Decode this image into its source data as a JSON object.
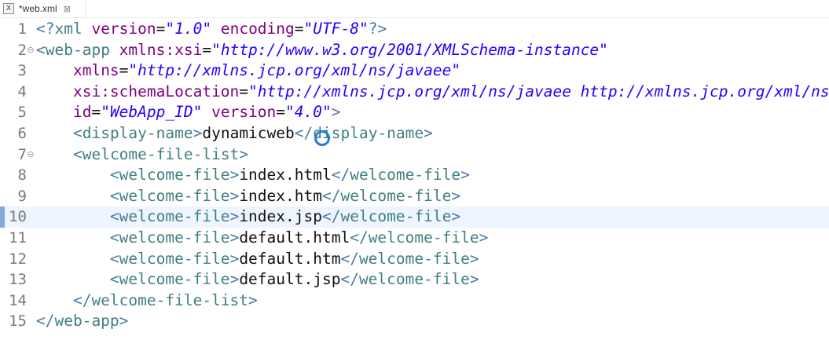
{
  "tab": {
    "icon_label": "X",
    "label": "*web.xml",
    "close": "⊠"
  },
  "lines": [
    {
      "n": "1",
      "fold": "",
      "code": [
        [
          "p",
          "<?"
        ],
        [
          "t",
          "xml "
        ],
        [
          "a",
          "version"
        ],
        [
          "x",
          "="
        ],
        [
          "v",
          "\"1.0\""
        ],
        [
          "x",
          " "
        ],
        [
          "a",
          "encoding"
        ],
        [
          "x",
          "="
        ],
        [
          "v",
          "\"UTF-8\""
        ],
        [
          "p",
          "?>"
        ]
      ]
    },
    {
      "n": "2",
      "fold": "⊖",
      "code": [
        [
          "p",
          "<"
        ],
        [
          "t",
          "web-app "
        ],
        [
          "a",
          "xmlns:xsi"
        ],
        [
          "x",
          "="
        ],
        [
          "v",
          "\"http://www.w3.org/2001/XMLSchema-instance\""
        ]
      ]
    },
    {
      "n": "3",
      "fold": "",
      "code": [
        [
          "x",
          "    "
        ],
        [
          "a",
          "xmlns"
        ],
        [
          "x",
          "="
        ],
        [
          "v",
          "\"http://xmlns.jcp.org/xml/ns/javaee\""
        ]
      ]
    },
    {
      "n": "4",
      "fold": "",
      "code": [
        [
          "x",
          "    "
        ],
        [
          "a",
          "xsi:schemaLocation"
        ],
        [
          "x",
          "="
        ],
        [
          "v",
          "\"http://xmlns.jcp.org/xml/ns/javaee http://xmlns.jcp.org/xml/ns/jav"
        ]
      ]
    },
    {
      "n": "5",
      "fold": "",
      "code": [
        [
          "x",
          "    "
        ],
        [
          "a",
          "id"
        ],
        [
          "x",
          "="
        ],
        [
          "v",
          "\"WebApp_ID\""
        ],
        [
          "x",
          " "
        ],
        [
          "a",
          "version"
        ],
        [
          "x",
          "="
        ],
        [
          "v",
          "\"4.0\""
        ],
        [
          "p",
          ">"
        ]
      ]
    },
    {
      "n": "6",
      "fold": "",
      "code": [
        [
          "x",
          "    "
        ],
        [
          "p",
          "<"
        ],
        [
          "t",
          "display-name"
        ],
        [
          "p",
          ">"
        ],
        [
          "x",
          "dynamicweb"
        ],
        [
          "p",
          "</"
        ],
        [
          "t",
          "display-name"
        ],
        [
          "p",
          ">"
        ]
      ]
    },
    {
      "n": "7",
      "fold": "⊖",
      "code": [
        [
          "x",
          "    "
        ],
        [
          "p",
          "<"
        ],
        [
          "t",
          "welcome-file-list"
        ],
        [
          "p",
          ">"
        ]
      ]
    },
    {
      "n": "8",
      "fold": "",
      "code": [
        [
          "x",
          "        "
        ],
        [
          "p",
          "<"
        ],
        [
          "t",
          "welcome-file"
        ],
        [
          "p",
          ">"
        ],
        [
          "x",
          "index.html"
        ],
        [
          "p",
          "</"
        ],
        [
          "t",
          "welcome-file"
        ],
        [
          "p",
          ">"
        ]
      ]
    },
    {
      "n": "9",
      "fold": "",
      "code": [
        [
          "x",
          "        "
        ],
        [
          "p",
          "<"
        ],
        [
          "t",
          "welcome-file"
        ],
        [
          "p",
          ">"
        ],
        [
          "x",
          "index.htm"
        ],
        [
          "p",
          "</"
        ],
        [
          "t",
          "welcome-file"
        ],
        [
          "p",
          ">"
        ]
      ]
    },
    {
      "n": "10",
      "fold": "",
      "current": true,
      "code": [
        [
          "x",
          "        "
        ],
        [
          "p",
          "<"
        ],
        [
          "t",
          "welcome-file"
        ],
        [
          "p",
          ">"
        ],
        [
          "x",
          "index.jsp"
        ],
        [
          "p",
          "</"
        ],
        [
          "t",
          "welcome-file"
        ],
        [
          "p",
          ">"
        ]
      ]
    },
    {
      "n": "11",
      "fold": "",
      "code": [
        [
          "x",
          "        "
        ],
        [
          "p",
          "<"
        ],
        [
          "t",
          "welcome-file"
        ],
        [
          "p",
          ">"
        ],
        [
          "x",
          "default.html"
        ],
        [
          "p",
          "</"
        ],
        [
          "t",
          "welcome-file"
        ],
        [
          "p",
          ">"
        ]
      ]
    },
    {
      "n": "12",
      "fold": "",
      "code": [
        [
          "x",
          "        "
        ],
        [
          "p",
          "<"
        ],
        [
          "t",
          "welcome-file"
        ],
        [
          "p",
          ">"
        ],
        [
          "x",
          "default.htm"
        ],
        [
          "p",
          "</"
        ],
        [
          "t",
          "welcome-file"
        ],
        [
          "p",
          ">"
        ]
      ]
    },
    {
      "n": "13",
      "fold": "",
      "code": [
        [
          "x",
          "        "
        ],
        [
          "p",
          "<"
        ],
        [
          "t",
          "welcome-file"
        ],
        [
          "p",
          ">"
        ],
        [
          "x",
          "default.jsp"
        ],
        [
          "p",
          "</"
        ],
        [
          "t",
          "welcome-file"
        ],
        [
          "p",
          ">"
        ]
      ]
    },
    {
      "n": "14",
      "fold": "",
      "code": [
        [
          "x",
          "    "
        ],
        [
          "p",
          "</"
        ],
        [
          "t",
          "welcome-file-list"
        ],
        [
          "p",
          ">"
        ]
      ]
    },
    {
      "n": "15",
      "fold": "",
      "code": [
        [
          "p",
          "</"
        ],
        [
          "t",
          "web-app"
        ],
        [
          "p",
          ">"
        ]
      ]
    }
  ],
  "colors": {
    "tag": "#3f7f7f",
    "punct": "#4a7aa3",
    "attr": "#7f007f",
    "value": "#2a00ff",
    "text": "#111111",
    "current_line": "#eef5ff"
  }
}
